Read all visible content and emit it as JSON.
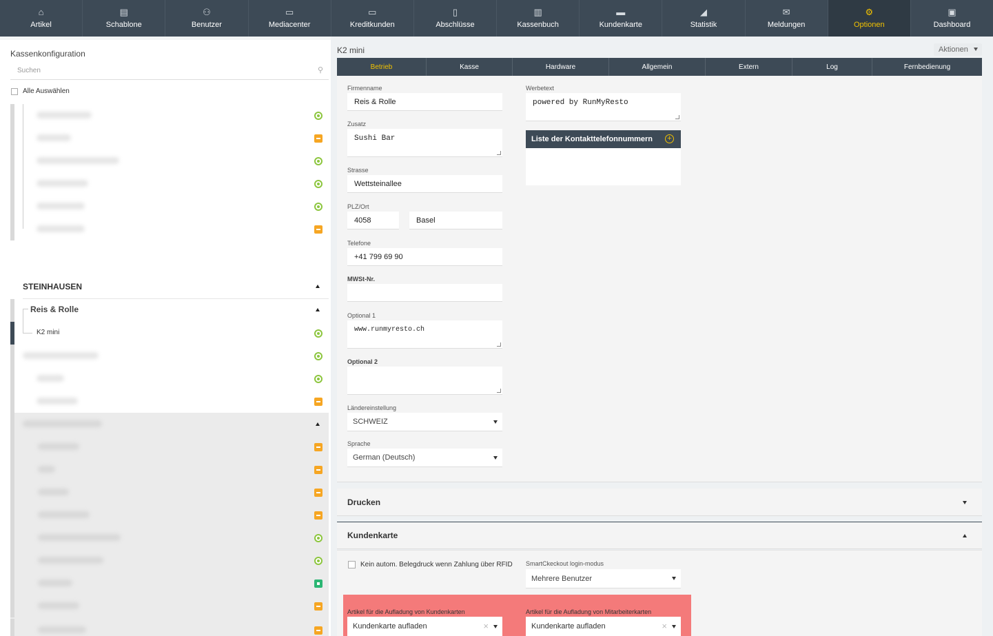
{
  "nav": [
    {
      "label": "Artikel",
      "icon": "cashier-icon"
    },
    {
      "label": "Schablone",
      "icon": "template-icon"
    },
    {
      "label": "Benutzer",
      "icon": "users-icon"
    },
    {
      "label": "Mediacenter",
      "icon": "monitor-icon"
    },
    {
      "label": "Kreditkunden",
      "icon": "credit-card-icon"
    },
    {
      "label": "Abschlüsse",
      "icon": "document-icon"
    },
    {
      "label": "Kassenbuch",
      "icon": "book-icon"
    },
    {
      "label": "Kundenkarte",
      "icon": "card-icon"
    },
    {
      "label": "Statistik",
      "icon": "chart-icon"
    },
    {
      "label": "Meldungen",
      "icon": "envelope-icon"
    },
    {
      "label": "Optionen",
      "icon": "gear-icon"
    },
    {
      "label": "Dashboard",
      "icon": "dashboard-icon"
    }
  ],
  "left": {
    "title": "Kassenkonfiguration",
    "search_placeholder": "Suchen",
    "select_all": "Alle Auswählen",
    "group": "STEINHAUSEN",
    "subgroup": "Reis & Rolle",
    "selected_item": "K2 mini"
  },
  "right": {
    "title": "K2 mini",
    "actions": "Aktionen",
    "tabs": [
      "Betrieb",
      "Kasse",
      "Hardware",
      "Allgemein",
      "Extern",
      "Log",
      "Fernbedienung"
    ]
  },
  "form": {
    "firmenname_label": "Firmenname",
    "firmenname": "Reis & Rolle",
    "zusatz_label": "Zusatz",
    "zusatz": "Sushi Bar",
    "strasse_label": "Strasse",
    "strasse": "Wettsteinallee",
    "plzort_label": "PLZ/Ort",
    "plz": "4058",
    "ort": "Basel",
    "telefone_label": "Telefone",
    "telefone": "+41 799 69 90",
    "mwst_label": "MWSt-Nr.",
    "mwst": "",
    "optional1_label": "Optional 1",
    "optional1": "www.runmyresto.ch",
    "optional2_label": "Optional 2",
    "optional2": "",
    "land_label": "Ländereinstellung",
    "land": "SCHWEIZ",
    "sprache_label": "Sprache",
    "sprache": "German (Deutsch)",
    "werbetext_label": "Werbetext",
    "werbetext": "powered by RunMyResto",
    "contacts_title": "Liste der Kontakttelefonnummern"
  },
  "sections": {
    "drucken": "Drucken",
    "kundenkarte": "Kundenkarte"
  },
  "kundenkarte": {
    "rfid_label": "Kein autom. Belegdruck wenn Zahlung über RFID",
    "smart_label": "SmartCkeckout login-modus",
    "smart_value": "Mehrere Benutzer",
    "kunden_label": "Artikel für die Aufladung von Kundenkarten",
    "kunden_value": "Kundenkarte aufladen",
    "mitarbeiter_label": "Artikel für die Aufladung von Mitarbeiterkarten",
    "mitarbeiter_value": "Kundenkarte aufladen"
  },
  "tree_status": [
    "green",
    "orange",
    "green",
    "green",
    "green",
    "orange",
    "green",
    "green",
    "green",
    "orange",
    "orange",
    "orange",
    "orange",
    "orange",
    "green",
    "green",
    "teal",
    "orange",
    "orange",
    "orange"
  ]
}
